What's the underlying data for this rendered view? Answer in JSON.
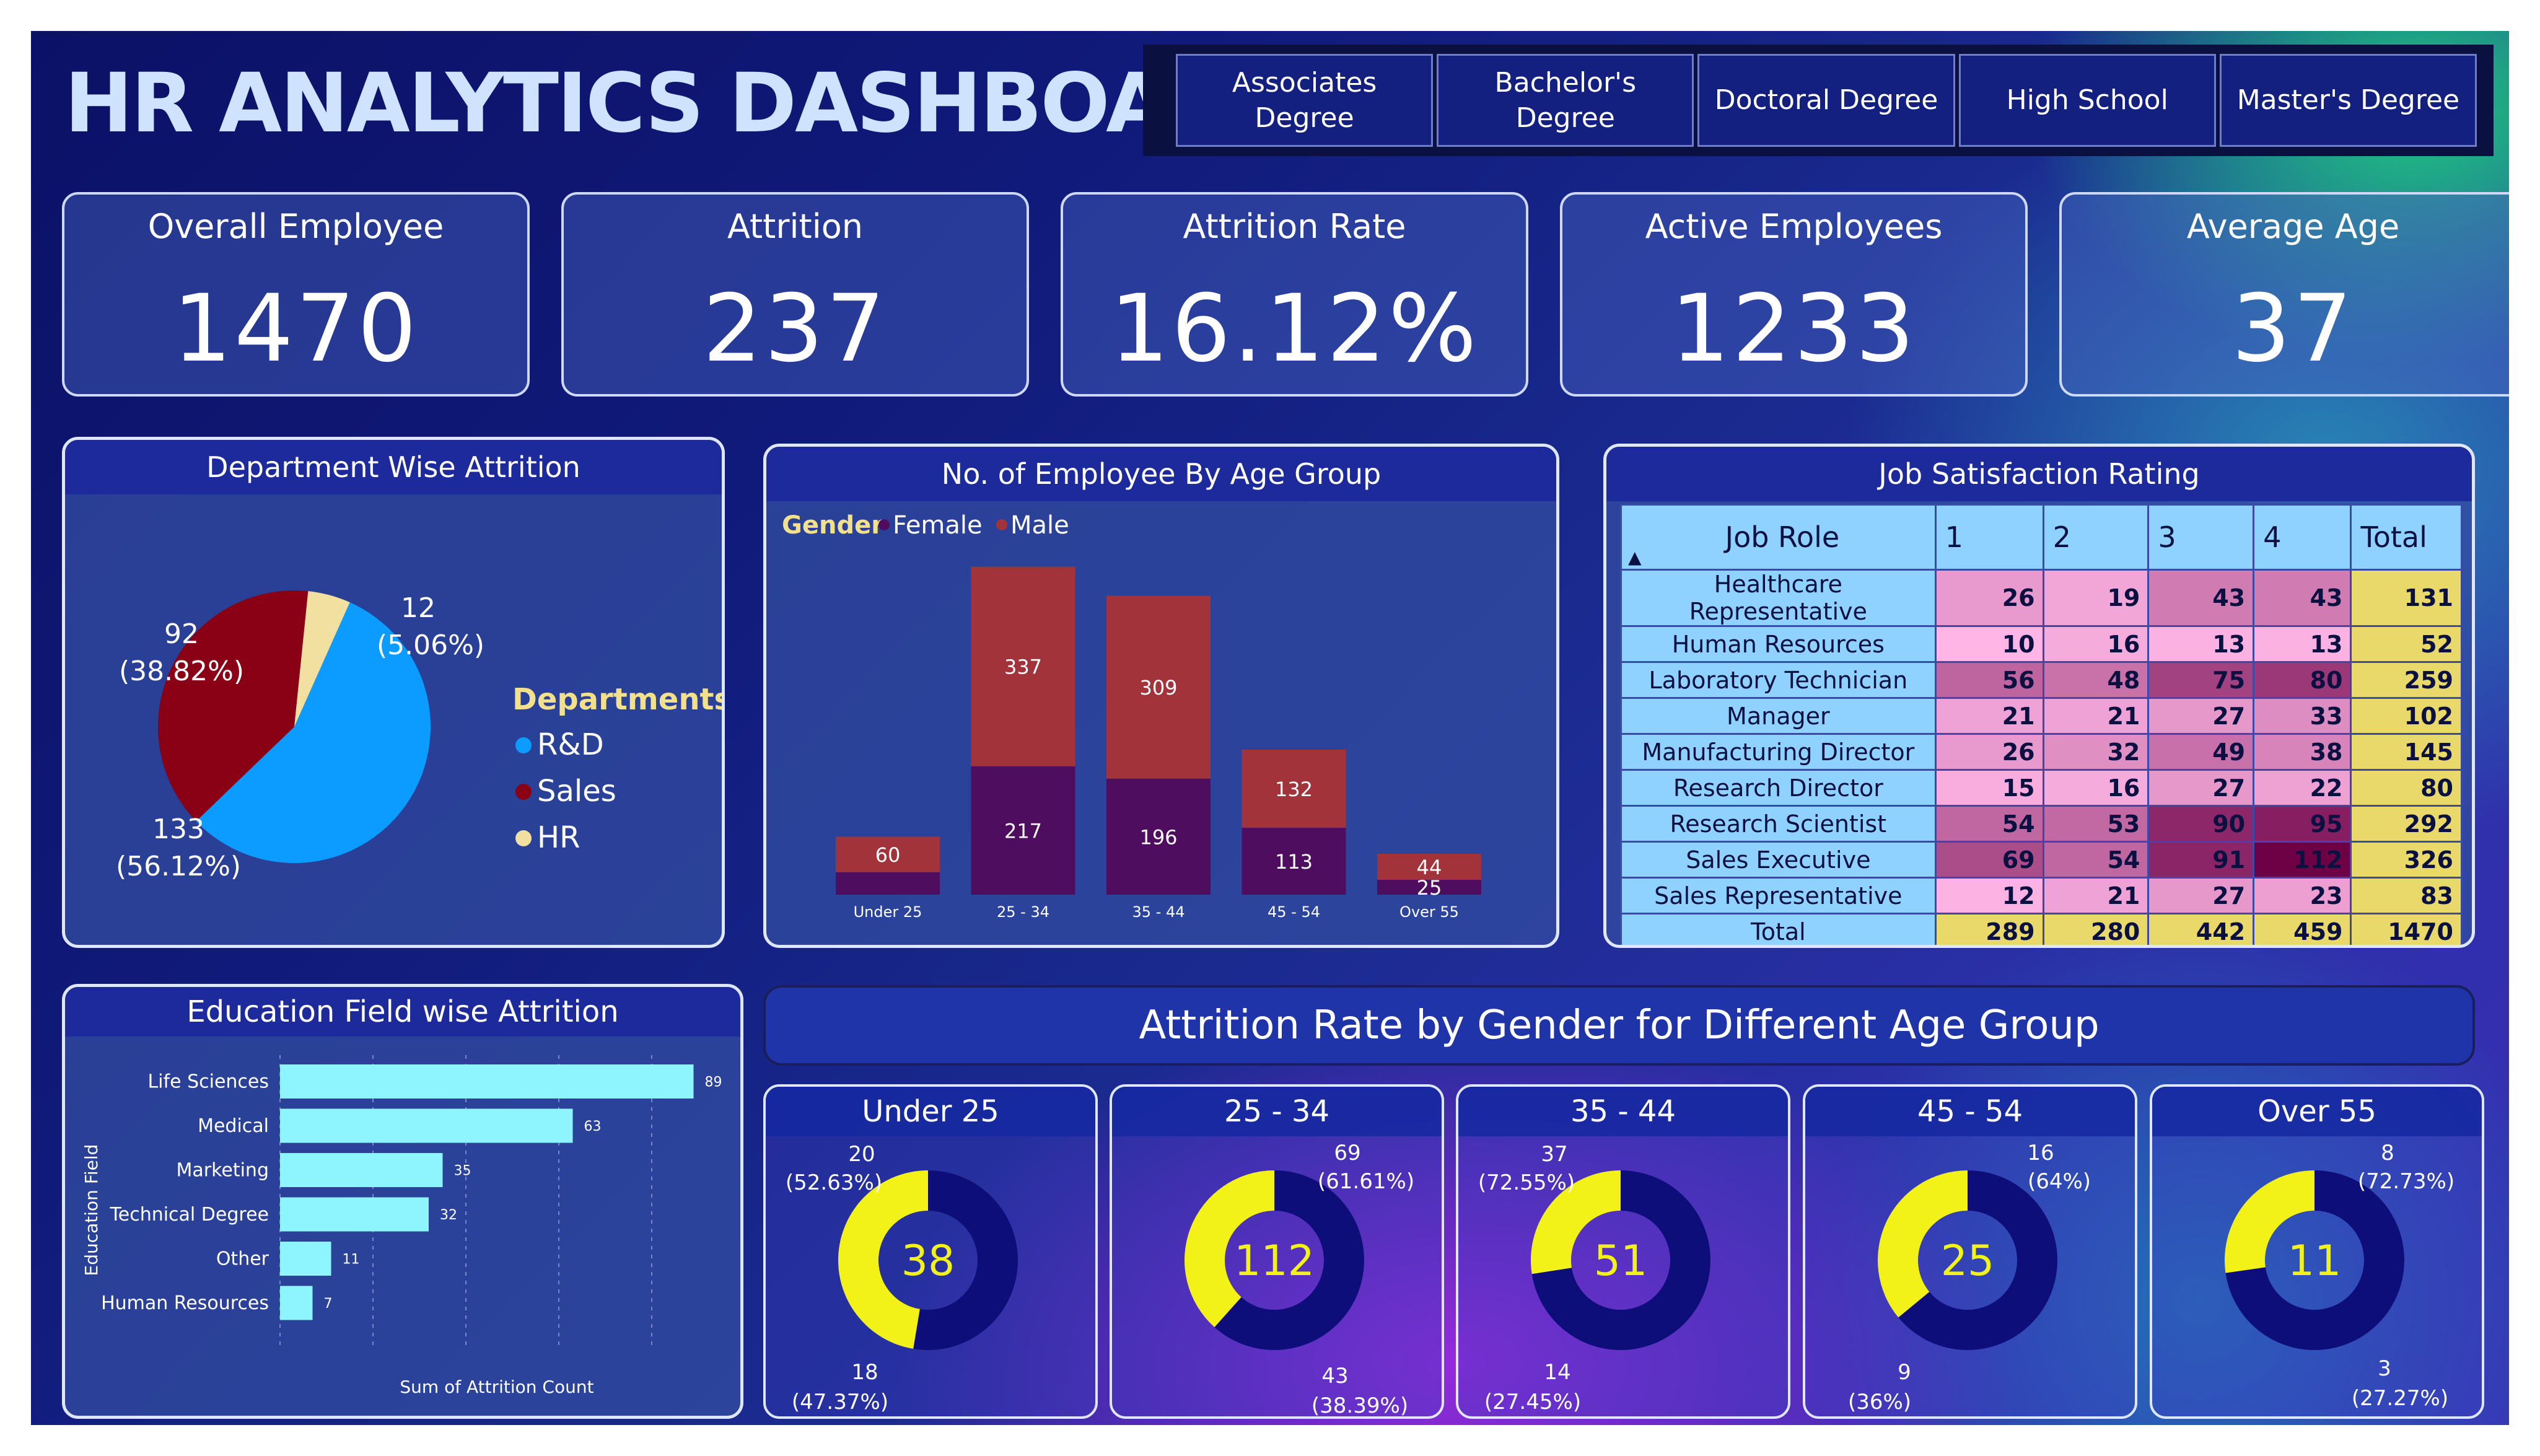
{
  "header": {
    "title": "HR ANALYTICS DASHBOARD"
  },
  "education_slicer": [
    {
      "label": "Associates\nDegree"
    },
    {
      "label": "Bachelor's\nDegree"
    },
    {
      "label": "Doctoral Degree"
    },
    {
      "label": "High School"
    },
    {
      "label": "Master's Degree"
    }
  ],
  "kpis": [
    {
      "label": "Overall Employee",
      "value": "1470"
    },
    {
      "label": "Attrition",
      "value": "237"
    },
    {
      "label": "Attrition Rate",
      "value": "16.12%"
    },
    {
      "label": "Active Employees",
      "value": "1233"
    },
    {
      "label": "Average Age",
      "value": "37"
    }
  ],
  "colors": {
    "rd": "#0c9bff",
    "sales": "#8a0014",
    "hr": "#f2e0a0",
    "female": "#4f0d5f",
    "male": "#a2333b",
    "edu_bar": "#8ef5ff",
    "donut_dark": "#0e0e7a",
    "donut_yellow": "#f2f218"
  },
  "chart_data": [
    {
      "type": "pie",
      "title": "Department Wise Attrition",
      "legend_title": "Departments",
      "legend_placement": "right",
      "slices": [
        {
          "name": "R&D",
          "value": 133,
          "percent": "56.12%",
          "value_label": "133",
          "percent_label": "(56.12%)"
        },
        {
          "name": "Sales",
          "value": 92,
          "percent": "38.82%",
          "value_label": "92",
          "percent_label": "(38.82%)"
        },
        {
          "name": "HR",
          "value": 12,
          "percent": "5.06%",
          "value_label": "12",
          "percent_label": "(5.06%)"
        }
      ]
    },
    {
      "type": "bar",
      "stacked": true,
      "title": "No. of Employee By Age Group",
      "legend_title": "Gender",
      "legend_placement": "top-left",
      "categories": [
        "Under 25",
        "25 - 34",
        "35 - 44",
        "45 - 54",
        "Over 55"
      ],
      "series": [
        {
          "name": "Female",
          "values": [
            38,
            217,
            196,
            113,
            25
          ],
          "labels": [
            "",
            "217",
            "196",
            "113",
            "25"
          ]
        },
        {
          "name": "Male",
          "values": [
            60,
            337,
            309,
            132,
            44
          ],
          "labels": [
            "60",
            "337",
            "309",
            "132",
            "44"
          ]
        }
      ],
      "ylim": [
        0,
        560
      ]
    },
    {
      "type": "table",
      "title": "Job Satisfaction Rating",
      "columns": [
        "Job Role",
        "1",
        "2",
        "3",
        "4",
        "Total"
      ],
      "rows": [
        {
          "role": "Healthcare Representative",
          "values": [
            26,
            19,
            43,
            43
          ],
          "total": 131
        },
        {
          "role": "Human Resources",
          "values": [
            10,
            16,
            13,
            13
          ],
          "total": 52
        },
        {
          "role": "Laboratory Technician",
          "values": [
            56,
            48,
            75,
            80
          ],
          "total": 259
        },
        {
          "role": "Manager",
          "values": [
            21,
            21,
            27,
            33
          ],
          "total": 102
        },
        {
          "role": "Manufacturing Director",
          "values": [
            26,
            32,
            49,
            38
          ],
          "total": 145
        },
        {
          "role": "Research Director",
          "values": [
            15,
            16,
            27,
            22
          ],
          "total": 80
        },
        {
          "role": "Research Scientist",
          "values": [
            54,
            53,
            90,
            95
          ],
          "total": 292
        },
        {
          "role": "Sales Executive",
          "values": [
            69,
            54,
            91,
            112
          ],
          "total": 326
        },
        {
          "role": "Sales Representative",
          "values": [
            12,
            21,
            27,
            23
          ],
          "total": 83
        }
      ],
      "totals": {
        "label": "Total",
        "values": [
          289,
          280,
          442,
          459
        ],
        "total": 1470
      }
    },
    {
      "type": "bar",
      "orientation": "horizontal",
      "title": "Education Field wise Attrition",
      "ylabel": "Education Field",
      "xlabel": "Sum of Attrition Count",
      "categories": [
        "Life Sciences",
        "Medical",
        "Marketing",
        "Technical Degree",
        "Other",
        "Human Resources"
      ],
      "values": [
        89,
        63,
        35,
        32,
        11,
        7
      ],
      "xlim": [
        0,
        100
      ],
      "grid": true
    },
    {
      "type": "pie",
      "donut": true,
      "section_title": "Attrition Rate by Gender for Different Age Group",
      "charts": [
        {
          "title": "Under 25",
          "total": "38",
          "male": {
            "value": 20,
            "label": "20",
            "pct": "(52.63%)"
          },
          "female": {
            "value": 18,
            "label": "18",
            "pct": "(47.37%)"
          }
        },
        {
          "title": "25 - 34",
          "total": "112",
          "male": {
            "value": 69,
            "label": "69",
            "pct": "(61.61%)"
          },
          "female": {
            "value": 43,
            "label": "43",
            "pct": "(38.39%)"
          }
        },
        {
          "title": "35 - 44",
          "total": "51",
          "male": {
            "value": 37,
            "label": "37",
            "pct": "(72.55%)"
          },
          "female": {
            "value": 14,
            "label": "14",
            "pct": "(27.45%)"
          }
        },
        {
          "title": "45 - 54",
          "total": "25",
          "male": {
            "value": 16,
            "label": "16",
            "pct": "(64%)"
          },
          "female": {
            "value": 9,
            "label": "9",
            "pct": "(36%)"
          }
        },
        {
          "title": "Over 55",
          "total": "11",
          "male": {
            "value": 8,
            "label": "8",
            "pct": "(72.73%)"
          },
          "female": {
            "value": 3,
            "label": "3",
            "pct": "(27.27%)"
          }
        }
      ]
    }
  ]
}
